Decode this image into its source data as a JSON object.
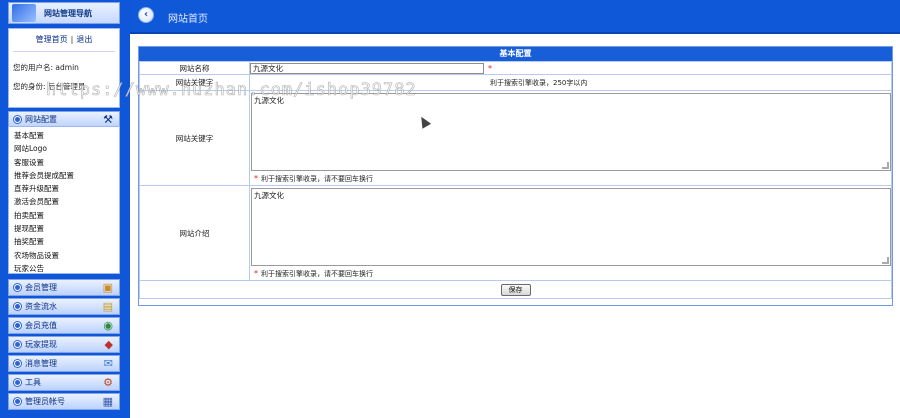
{
  "sidebar": {
    "logo_text": "网站管理导航",
    "links": {
      "home": "管理首页",
      "sep": "|",
      "logout": "退出"
    },
    "username_line": "您的用户名: admin",
    "role_line": "您的身份:  后台管理员",
    "active_group": {
      "label": "网站配置",
      "icon": "tools-icon"
    },
    "submenu": [
      "基本配置",
      "网站Logo",
      "客服设置",
      "推荐会员提成配置",
      "直荐升级配置",
      "激活会员配置",
      "拍卖配置",
      "提现配置",
      "抽奖配置",
      "农场物品设置",
      "玩家公告"
    ],
    "groups": [
      {
        "label": "会员管理",
        "icon": "users-icon"
      },
      {
        "label": "资金流水",
        "icon": "money-icon"
      },
      {
        "label": "会员充值",
        "icon": "recharge-icon"
      },
      {
        "label": "玩家提现",
        "icon": "withdraw-icon"
      },
      {
        "label": "消息管理",
        "icon": "message-icon"
      },
      {
        "label": "工具",
        "icon": "tool-icon"
      },
      {
        "label": "管理员帐号",
        "icon": "admin-icon"
      }
    ]
  },
  "topbar": {
    "title": "网站首页",
    "back_icon": "back-icon"
  },
  "panel": {
    "title": "基本配置",
    "rows": {
      "site_name": {
        "label": "网站名称",
        "value": "九源文化",
        "required": "*"
      },
      "site_title_kw": {
        "label": "网站关键字",
        "hint": "利于搜索引擎收录，250字以内"
      },
      "site_keywords": {
        "label": "网站关键字",
        "value": "九源文化",
        "hint": "利于搜索引擎收录，请不要回车换行"
      },
      "site_intro": {
        "label": "网站介绍",
        "value": "九源文化",
        "hint": "利于搜索引擎收录，请不要回车换行"
      }
    },
    "save_label": "保存"
  },
  "watermark": "https://www.huzhan.com/ishop39782"
}
